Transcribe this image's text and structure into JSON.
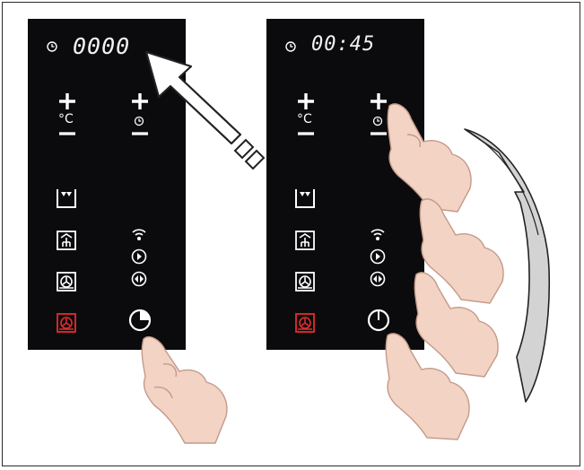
{
  "step1": {
    "display": "0000",
    "active_function_color": "#e52b2b"
  },
  "step2": {
    "display": "00:45",
    "active_function_color": "#e52b2b"
  },
  "icons": {
    "clock": "clock-icon",
    "temp_plus": "plus-icon",
    "temp_unit": "°C",
    "temp_minus": "minus-icon",
    "time_plus": "plus-icon",
    "time_minus": "minus-icon",
    "functions": [
      "top-heat-icon",
      "grill-icon",
      "fan-icon",
      "fan-ring-heat-icon"
    ],
    "right_column": [
      "signal-icon",
      "play-icon",
      "double-arrow-icon",
      "timer-icon"
    ]
  }
}
